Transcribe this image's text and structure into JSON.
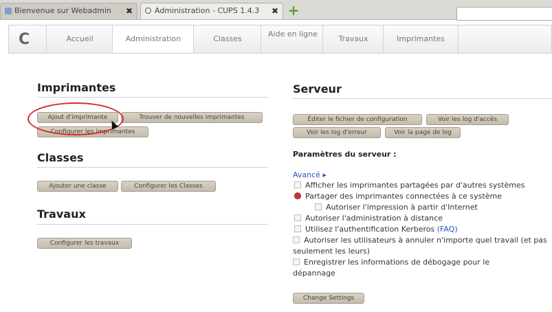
{
  "browser": {
    "tabs": [
      {
        "title": "Bienvenue sur Webadmin",
        "close": "✖"
      },
      {
        "title": "Administration - CUPS 1.4.3",
        "close": "✖"
      }
    ],
    "new_tab_symbol": "+"
  },
  "nav": {
    "logo": "C",
    "items": [
      {
        "label": "Accueil"
      },
      {
        "label": "Administration"
      },
      {
        "label": "Classes"
      },
      {
        "label": "Aide en ligne"
      },
      {
        "label": "Travaux"
      },
      {
        "label": "Imprimantes"
      }
    ],
    "search_value": ""
  },
  "printers": {
    "heading": "Imprimantes",
    "buttons": [
      "Ajout d'imprimante",
      "Trouver de nouvelles imprimantes",
      "Configurer les imprimantes"
    ]
  },
  "classes": {
    "heading": "Classes",
    "buttons": [
      "Ajouter une classe",
      "Configurer les Classes"
    ]
  },
  "jobs": {
    "heading": "Travaux",
    "buttons": [
      "Configurer les travaux"
    ]
  },
  "server": {
    "heading": "Serveur",
    "buttons": [
      "Éditer le fichier de configuration",
      "Voir les log d'accès",
      "Voir les log d'erreur",
      "Voir la page de log"
    ],
    "params_label": "Paramètres du serveur :",
    "advanced_link": "Avancé ▸",
    "options": [
      {
        "label": "Afficher les imprimantes partagées par d'autres systèmes",
        "checked": false
      },
      {
        "label": "Partager des imprimantes connectées à ce système",
        "checked": true
      },
      {
        "label": "Autoriser l'impression à partir d'Internet",
        "checked": false
      },
      {
        "label": "Autoriser l'administration à distance",
        "checked": false
      },
      {
        "label": "Utilisez l'authentification Kerberos",
        "checked": false
      },
      {
        "label": "Autoriser les utilisateurs à annuler n'importe quel travail (et pas seulement les leurs)",
        "checked": false
      },
      {
        "label": "Enregistrer les informations de débogage pour le dépannage",
        "checked": false
      }
    ],
    "faq_link": "(FAQ)",
    "change_button": "Change Settings"
  },
  "colors": {
    "highlight_circle": "#d42a2a",
    "link": "#2b53b4"
  }
}
